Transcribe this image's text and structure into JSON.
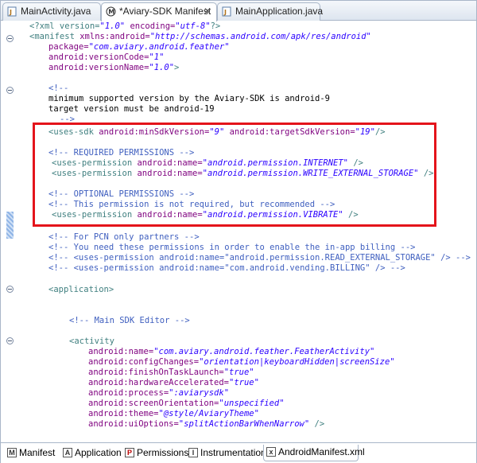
{
  "top_tabs": [
    {
      "label": "MainActivity.java",
      "icon": "java-file-icon"
    },
    {
      "label": "*Aviary-SDK Manifest",
      "icon": "manifest-icon",
      "close": "✕"
    },
    {
      "label": "MainApplication.java",
      "icon": "java-file-icon"
    }
  ],
  "code": {
    "l1": {
      "a": "<?xml version=",
      "b": "\"1.0\"",
      "c": " encoding=",
      "d": "\"utf-8\"",
      "e": "?>"
    },
    "l2": {
      "a": "<manifest",
      "b": " xmlns:android=",
      "c": "\"http://schemas.android.com/apk/res/android\""
    },
    "l3": {
      "a": "package=",
      "b": "\"com.aviary.android.feather\""
    },
    "l4": {
      "a": "android:versionCode=",
      "b": "\"1\""
    },
    "l5": {
      "a": "android:versionName=",
      "b": "\"1.0\"",
      "c": ">"
    },
    "l6": "<!--",
    "l7": "minimum supported version by the Aviary-SDK is android-9",
    "l8": "target version must be android-19",
    "l9": "-->",
    "l10": {
      "a": "<uses-sdk",
      "b": " android:minSdkVersion=",
      "c": "\"9\"",
      "d": " android:targetSdkVersion=",
      "e": "\"19\"",
      "f": "/>"
    },
    "l11": "<!-- REQUIRED PERMISSIONS -->",
    "l12": {
      "a": "<uses-permission",
      "b": " android:name=",
      "c": "\"android.permission.INTERNET\"",
      "d": " />"
    },
    "l13": {
      "a": "<uses-permission",
      "b": " android:name=",
      "c": "\"android.permission.WRITE_EXTERNAL_STORAGE\"",
      "d": " />"
    },
    "l14": "<!-- OPTIONAL PERMISSIONS -->",
    "l15": "<!-- This permission is not required, but recommended -->",
    "l16": {
      "a": "<uses-permission",
      "b": " android:name=",
      "c": "\"android.permission.VIBRATE\"",
      "d": " />"
    },
    "l17": "<!-- For PCN only partners -->",
    "l18": "<!-- You need these permissions in order to enable the in-app billing -->",
    "l19": "<!-- <uses-permission android:name=\"android.permission.READ_EXTERNAL_STORAGE\" /> -->",
    "l20": "<!-- <uses-permission android:name=\"com.android.vending.BILLING\" /> -->",
    "l21": "<application>",
    "l22": "<!-- Main SDK Editor -->",
    "l23": "<activity",
    "l24": {
      "a": "android:name=",
      "b": "\"com.aviary.android.feather.FeatherActivity\""
    },
    "l25": {
      "a": "android:configChanges=",
      "b": "\"orientation|keyboardHidden|screenSize\""
    },
    "l26": {
      "a": "android:finishOnTaskLaunch=",
      "b": "\"true\""
    },
    "l27": {
      "a": "android:hardwareAccelerated=",
      "b": "\"true\""
    },
    "l28": {
      "a": "android:process=",
      "b": "\":aviarysdk\""
    },
    "l29": {
      "a": "android:screenOrientation=",
      "b": "\"unspecified\""
    },
    "l30": {
      "a": "android:theme=",
      "b": "\"@style/AviaryTheme\""
    },
    "l31": {
      "a": "android:uiOptions=",
      "b": "\"splitActionBarWhenNarrow\"",
      "c": " />"
    }
  },
  "bottom_tabs": [
    {
      "label": "Manifest",
      "icon_text": "M"
    },
    {
      "label": "Application",
      "icon_text": "A"
    },
    {
      "label": "Permissions",
      "icon_text": "P"
    },
    {
      "label": "Instrumentation",
      "icon_text": "I"
    },
    {
      "label": "AndroidManifest.xml",
      "icon_text": "x"
    }
  ],
  "colors": {
    "highlight_border": "#e4141b",
    "tag": "#3f7f7f",
    "attr": "#7f007f",
    "value": "#2a00ff",
    "comment": "#3f5fbf"
  }
}
